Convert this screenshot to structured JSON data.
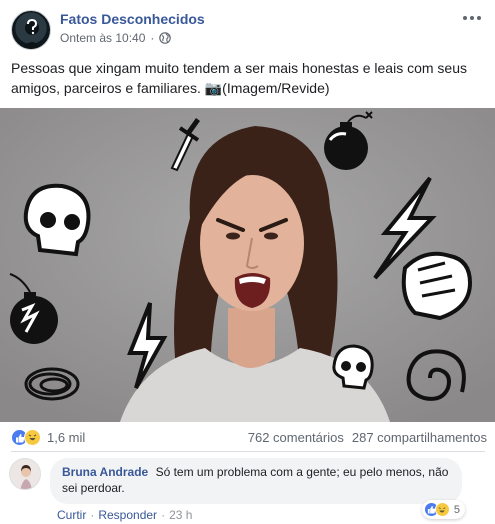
{
  "post": {
    "page_name": "Fatos Desconhecidos",
    "timestamp": "Ontem às 10:40",
    "separator": "·",
    "privacy_icon": "globe-icon",
    "text": "Pessoas que xingam muito tendem a ser mais honestas e leais com seus amigos, parceiros e familiares. 📷(Imagem/Revide)"
  },
  "stats": {
    "reaction_icons": [
      "like-icon",
      "haha-icon"
    ],
    "reaction_count": "1,6 mil",
    "comments": "762 comentários",
    "shares": "287 compartilhamentos"
  },
  "comment": {
    "author": "Bruna Andrade",
    "text": "Só tem um problema com a gente; eu pelo menos, não sei perdoar.",
    "reaction_count": "5",
    "actions": {
      "like": "Curtir",
      "reply": "Responder",
      "time": "23 h",
      "sep": "·"
    }
  },
  "colors": {
    "link": "#385898",
    "meta": "#616770",
    "bubble": "#f2f3f5",
    "like": "#4a7cf0",
    "haha": "#f7c940"
  }
}
